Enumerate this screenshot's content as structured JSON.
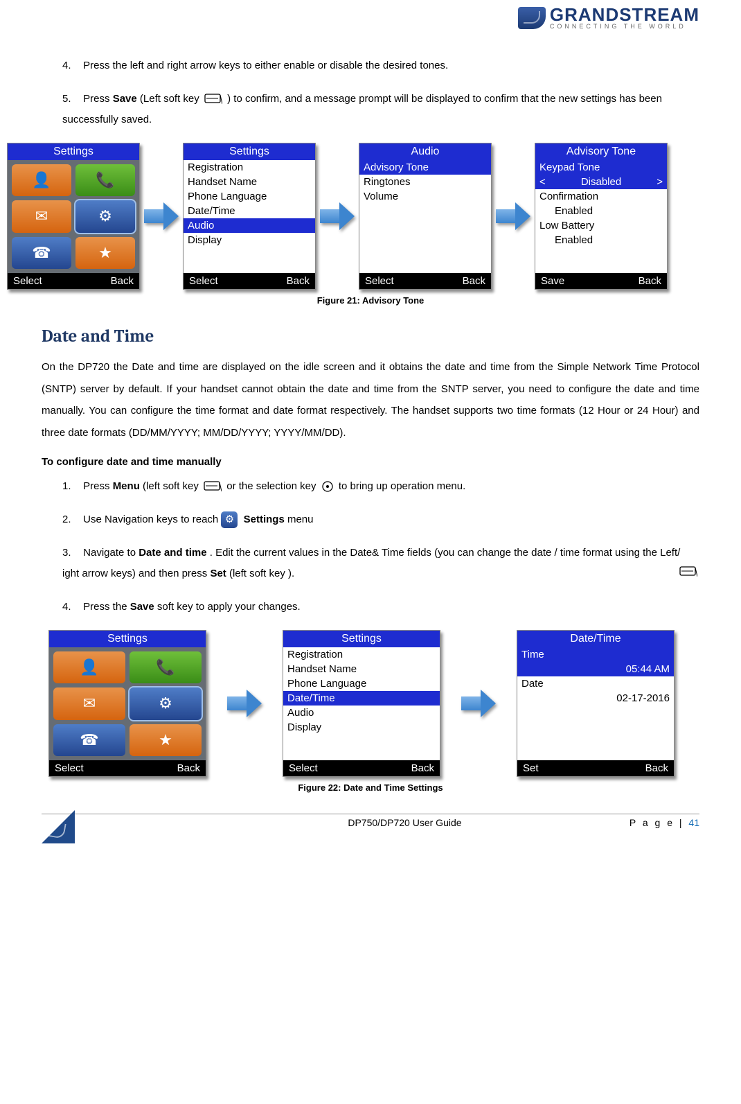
{
  "logo": {
    "main": "GRANDSTREAM",
    "sub": "CONNECTING THE WORLD"
  },
  "top_steps": [
    {
      "n": "4.",
      "pre": "Press the left and right arrow keys to either enable or disable the desired tones.",
      "bold": "",
      "post": ""
    },
    {
      "n": "5.",
      "pre": "Press ",
      "bold": "Save",
      "post": " (Left soft key ",
      "tail": " ) to confirm, and a message prompt will be displayed to confirm that the new settings has been successfully saved."
    }
  ],
  "fig21": {
    "caption": "Figure 21: Advisory Tone",
    "s1": {
      "title": "Settings",
      "foot_l": "Select",
      "foot_r": "Back"
    },
    "s2": {
      "title": "Settings",
      "items": [
        "Registration",
        "Handset Name",
        "Phone Language",
        "Date/Time",
        "Audio",
        "Display"
      ],
      "sel_index": 4,
      "foot_l": "Select",
      "foot_r": "Back"
    },
    "s3": {
      "title": "Audio",
      "items": [
        "Advisory Tone",
        "Ringtones",
        "Volume"
      ],
      "sel_index": 0,
      "foot_l": "Select",
      "foot_r": "Back"
    },
    "s4": {
      "title": "Advisory Tone",
      "rows": [
        {
          "label": "Keypad Tone",
          "value": "Disabled",
          "sel": true,
          "arrows": true
        },
        {
          "label": "Confirmation",
          "value": "Enabled",
          "sel": false,
          "arrows": false
        },
        {
          "label": "Low Battery",
          "value": "Enabled",
          "sel": false,
          "arrows": false
        }
      ],
      "foot_l": "Save",
      "foot_r": "Back"
    }
  },
  "section_heading": "Date and Time",
  "section_body": "On the DP720 the Date and time are displayed on the idle screen and it obtains the date and time from the Simple Network Time Protocol (SNTP) server by default. If your handset cannot obtain the date and time from the SNTP server, you need to configure the date and time manually. You can configure the time format and date format respectively. The handset supports two time formats (12 Hour or 24 Hour) and three date formats (DD/MM/YYYY; MM/DD/YYYY; YYYY/MM/DD).",
  "subhead": "To configure date and time manually",
  "dt_steps": {
    "s1": {
      "n": "1.",
      "a": "Press ",
      "b": "Menu",
      "c": " (left soft key ",
      "d": " or the selection key ",
      "e": " to bring up operation menu."
    },
    "s2": {
      "n": "2.",
      "a": "Use Navigation keys to reach ",
      "b": "Settings",
      "c": " menu"
    },
    "s3": {
      "n": "3.",
      "a": "Navigate to ",
      "b": "Date and time",
      "c": ". Edit the current values in the Date& Time fields (you can change the date / time format using the Left/  ight arrow  keys) and then press ",
      "d": "Set",
      "e": " (left soft key )."
    },
    "s4": {
      "n": "4.",
      "a": "Press the ",
      "b": "Save",
      "c": " soft key to apply your changes."
    }
  },
  "fig22": {
    "caption": "Figure 22: Date and Time Settings",
    "s1": {
      "title": "Settings",
      "foot_l": "Select",
      "foot_r": "Back"
    },
    "s2": {
      "title": "Settings",
      "items": [
        "Registration",
        "Handset Name",
        "Phone Language",
        "Date/Time",
        "Audio",
        "Display"
      ],
      "sel_index": 3,
      "foot_l": "Select",
      "foot_r": "Back"
    },
    "s3": {
      "title": "Date/Time",
      "rows": [
        {
          "label": "Time",
          "value": "05:44 AM",
          "sel": true
        },
        {
          "label": "Date",
          "value": "02-17-2016",
          "sel": false
        }
      ],
      "foot_l": "Set",
      "foot_r": "Back"
    }
  },
  "footer": {
    "guide": "DP750/DP720 User Guide",
    "page_label": "P a g e | ",
    "page_num": "41"
  }
}
